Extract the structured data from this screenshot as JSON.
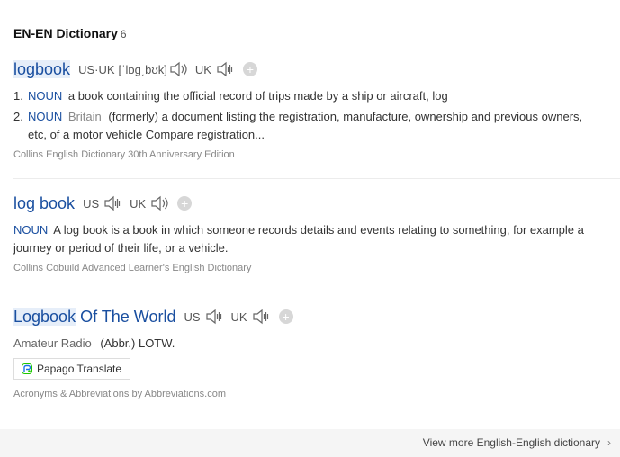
{
  "header": {
    "title": "EN-EN Dictionary",
    "count": "6"
  },
  "entries": [
    {
      "word_highlight": "logbook",
      "word_rest": "",
      "pron_us_uk_tag": "US·UK",
      "pron_ipa": "[ˈlɒɡ͵bʊk]",
      "pron_uk_tag": "UK",
      "definitions": [
        {
          "num": "1.",
          "pos": "NOUN",
          "label": "",
          "text": "a book containing the official record of trips made by a ship or aircraft, log"
        },
        {
          "num": "2.",
          "pos": "NOUN",
          "label": "Britain",
          "text": "(formerly) a document listing the registration, manufacture, ownership and previous owners, etc, of a motor vehicle Compare registration..."
        }
      ],
      "source": "Collins English Dictionary 30th Anniversary Edition"
    },
    {
      "word": "log book",
      "pron_us_tag": "US",
      "pron_uk_tag": "UK",
      "pos": "NOUN",
      "text": "A log book is a book in which someone records details and events relating to something, for example a journey or period of their life, or a vehicle.",
      "source": "Collins Cobuild Advanced Learner's English Dictionary"
    },
    {
      "word_highlight": "Logbook",
      "word_rest": " Of The World",
      "pron_us_tag": "US",
      "pron_uk_tag": "UK",
      "domain": "Amateur Radio",
      "text": "(Abbr.) LOTW.",
      "translate_label": "Papago Translate",
      "source": "Acronyms & Abbreviations by Abbreviations.com"
    }
  ],
  "footer": {
    "more_label": "View more English-English dictionary"
  },
  "icons": [
    "speaker-icon",
    "plus-icon",
    "papago-icon",
    "chevron-right-icon"
  ],
  "colors": {
    "link": "#1a4fa0",
    "highlight": "#e6eef9",
    "muted": "#888888"
  }
}
